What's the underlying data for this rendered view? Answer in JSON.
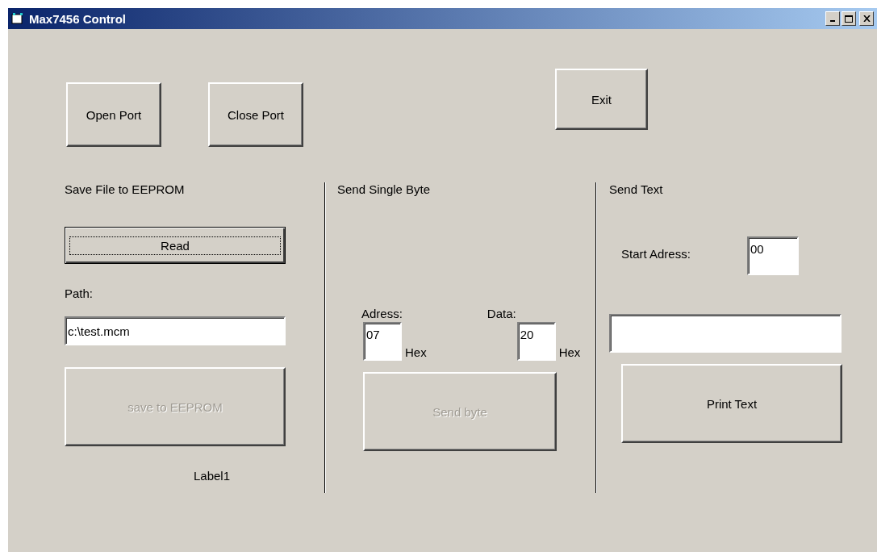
{
  "window": {
    "title": "Max7456 Control"
  },
  "top_buttons": [
    {
      "label": "Open Port",
      "disabled": false
    },
    {
      "label": "Close Port",
      "disabled": false
    }
  ],
  "exit_button": {
    "label": "Exit",
    "disabled": false
  },
  "save_section": {
    "heading": "Save File to EEPROM",
    "read_button": {
      "label": "Read",
      "default": true
    },
    "path_label": "Path:",
    "path_value": "c:\\test.mcm",
    "save_button": {
      "label": "save to EEPROM",
      "disabled": true
    },
    "status_label": "Label1"
  },
  "byte_section": {
    "heading": "Send Single Byte",
    "address_label": "Adress:",
    "data_label": "Data:",
    "address_value": "07",
    "data_value": "20",
    "address_unit": "Hex",
    "data_unit": "Hex",
    "send_button": {
      "label": "Send byte",
      "disabled": true
    }
  },
  "text_section": {
    "heading": "Send Text",
    "start_label": "Start Adress:",
    "start_value": "00",
    "print_button": {
      "label": "Print Text",
      "disabled": false
    }
  }
}
